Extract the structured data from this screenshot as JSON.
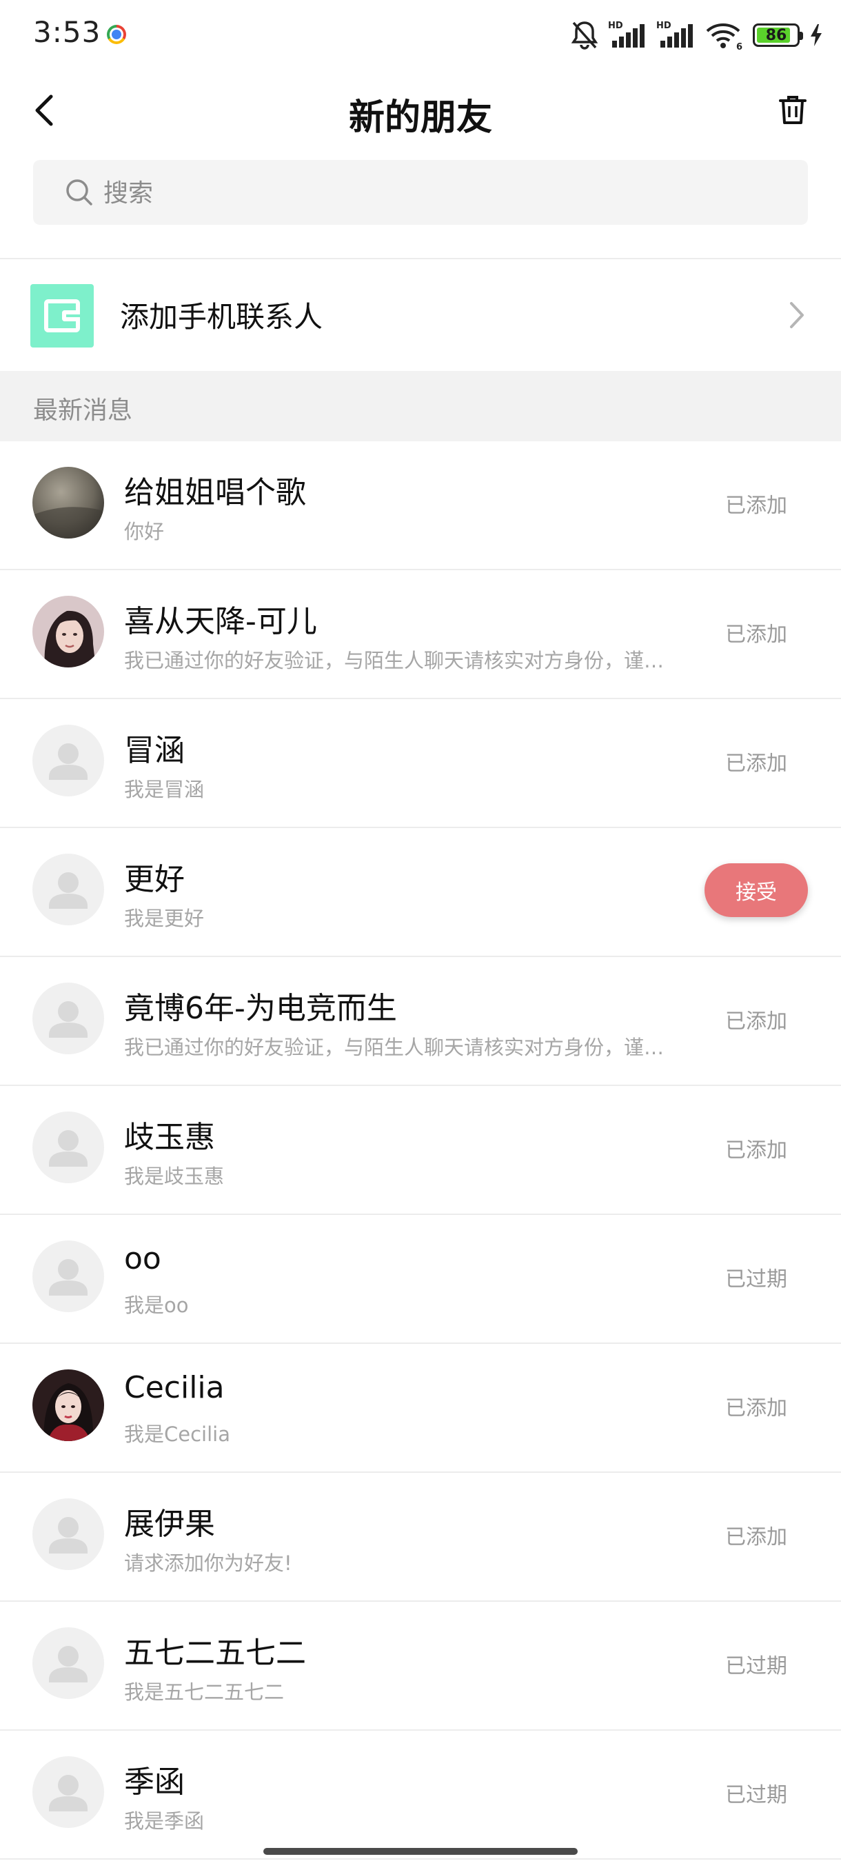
{
  "status_bar": {
    "time": "3:53",
    "battery_level": 86,
    "battery_text": "86",
    "signal_label_1": "HD",
    "signal_label_2": "HD",
    "wifi_sub": "6"
  },
  "header": {
    "title": "新的朋友"
  },
  "search": {
    "placeholder": "搜索"
  },
  "add_contacts": {
    "label": "添加手机联系人"
  },
  "section": {
    "title": "最新消息"
  },
  "colors": {
    "accent_accept": "#e8777a",
    "contacts_icon_bg": "#7ef0cb",
    "battery_green": "#5ad12b"
  },
  "friends": [
    {
      "name": "给姐姐唱个歌",
      "message": "你好",
      "status": "已添加",
      "avatar": "photo-gray"
    },
    {
      "name": "喜从天降-可儿",
      "message": "我已通过你的好友验证，与陌生人聊天请核实对方身份，谨防诈骗",
      "status": "已添加",
      "avatar": "photo-portrait"
    },
    {
      "name": "冒涵",
      "message": "我是冒涵",
      "status": "已添加",
      "avatar": "default"
    },
    {
      "name": "更好",
      "message": "我是更好",
      "status": "接受",
      "avatar": "default"
    },
    {
      "name": "竟博6年-为电竞而生",
      "message": "我已通过你的好友验证，与陌生人聊天请核实对方身份，谨防诈骗",
      "status": "已添加",
      "avatar": "default"
    },
    {
      "name": "歧玉惠",
      "message": "我是歧玉惠",
      "status": "已添加",
      "avatar": "default"
    },
    {
      "name": "oo",
      "message": "我是oo",
      "status": "已过期",
      "avatar": "default"
    },
    {
      "name": "Cecilia",
      "message": "我是Cecilia",
      "status": "已添加",
      "avatar": "photo-red"
    },
    {
      "name": "展伊果",
      "message": "请求添加你为好友!",
      "status": "已添加",
      "avatar": "default"
    },
    {
      "name": "五七二五七二",
      "message": "我是五七二五七二",
      "status": "已过期",
      "avatar": "default"
    },
    {
      "name": "季函",
      "message": "我是季函",
      "status": "已过期",
      "avatar": "default"
    }
  ]
}
